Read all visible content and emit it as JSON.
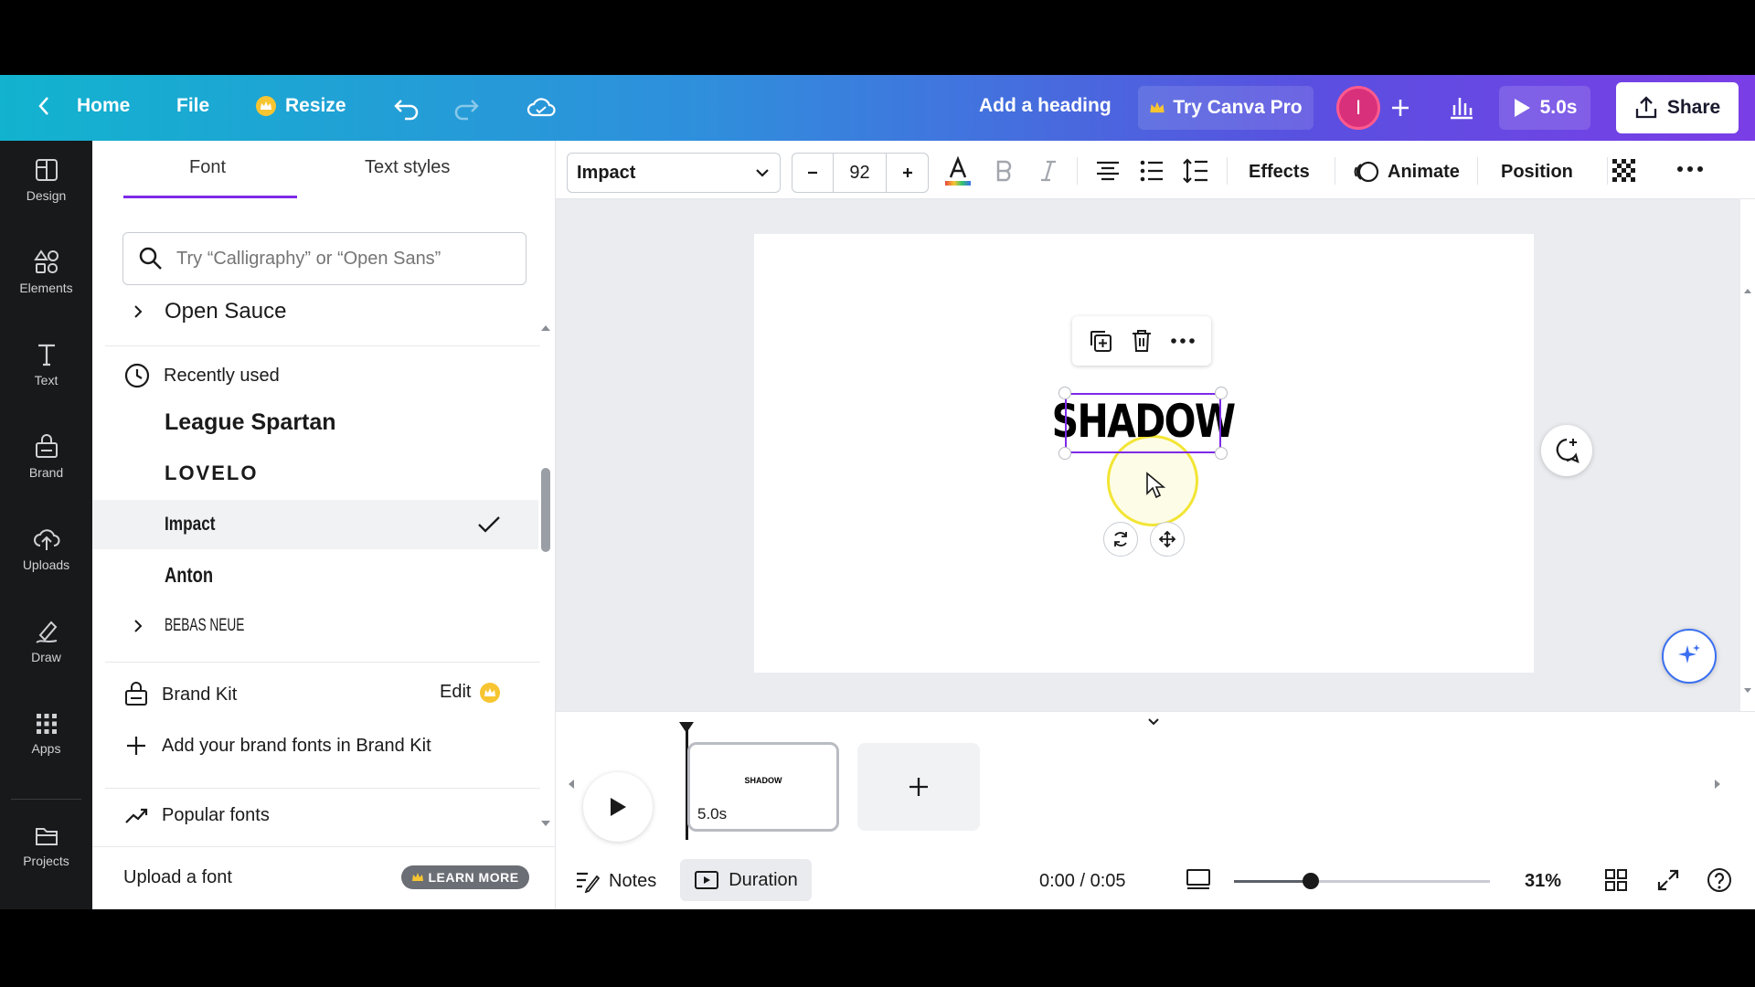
{
  "header": {
    "home_label": "Home",
    "file_label": "File",
    "resize_label": "Resize",
    "heading_label": "Add a heading",
    "try_pro_label": "Try Canva Pro",
    "avatar_initial": "I",
    "play_duration": "5.0s",
    "share_label": "Share"
  },
  "rail": {
    "items": [
      {
        "label": "Design",
        "icon": "layout-icon"
      },
      {
        "label": "Elements",
        "icon": "shapes-icon"
      },
      {
        "label": "Text",
        "icon": "text-icon"
      },
      {
        "label": "Brand",
        "icon": "brand-icon"
      },
      {
        "label": "Uploads",
        "icon": "cloud-upload-icon"
      },
      {
        "label": "Draw",
        "icon": "pen-icon"
      },
      {
        "label": "Apps",
        "icon": "grid-icon"
      },
      {
        "label": "Projects",
        "icon": "folder-icon"
      }
    ]
  },
  "panel": {
    "tab_font": "Font",
    "tab_text_styles": "Text styles",
    "search_placeholder": "Try “Calligraphy” or “Open Sans”",
    "open_sauce": "Open Sauce",
    "recently_used": "Recently used",
    "fonts": [
      "League Spartan",
      "LOVELO",
      "Impact",
      "Anton",
      "BEBAS NEUE"
    ],
    "selected_font": "Impact",
    "brand_kit": "Brand Kit",
    "brand_kit_edit": "Edit",
    "add_brand_fonts": "Add your brand fonts in Brand Kit",
    "popular_fonts": "Popular fonts",
    "upload_font": "Upload a font",
    "learn_more": "LEARN MORE"
  },
  "toolbar": {
    "font_name": "Impact",
    "font_size": "92",
    "effects": "Effects",
    "animate": "Animate",
    "position": "Position"
  },
  "canvas": {
    "text": "SHADOW"
  },
  "timeline": {
    "thumb_text": "SHADOW",
    "thumb_duration": "5.0s"
  },
  "footer": {
    "notes": "Notes",
    "duration": "Duration",
    "time": "0:00 / 0:05",
    "zoom": "31%",
    "zoom_fraction": 0.3
  },
  "colors": {
    "accent": "#7d2ae8",
    "rail_bg": "#18191b"
  }
}
